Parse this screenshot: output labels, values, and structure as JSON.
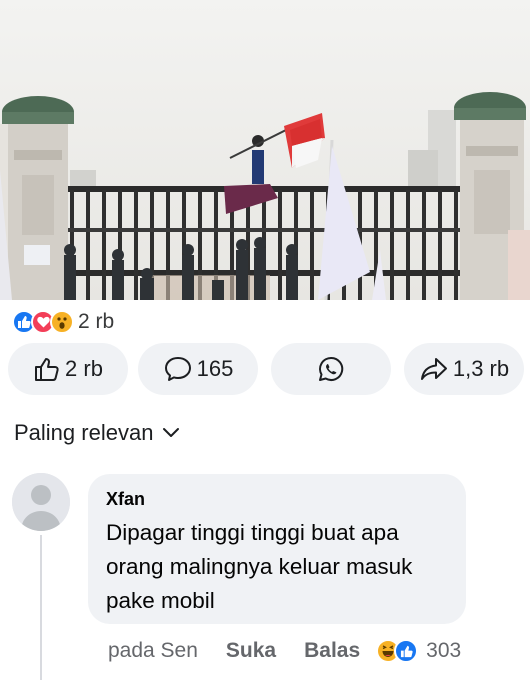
{
  "post": {
    "image_name": "protest-at-parliament-gate-photo",
    "reactions": {
      "icons": [
        "like-icon",
        "love-icon",
        "wow-icon"
      ],
      "count": "2 rb"
    }
  },
  "actions": {
    "like_count": "2 rb",
    "comment_count": "165",
    "share_count": "1,3 rb"
  },
  "comments_sort": {
    "label": "Paling relevan"
  },
  "comment": {
    "author": "Xfan",
    "text_lines": [
      "Dipagar tinggi tinggi buat apa",
      "orang malingnya keluar masuk",
      "pake mobil"
    ],
    "time": "pada Sen",
    "like_label": "Suka",
    "reply_label": "Balas",
    "reaction_icons": [
      "haha-icon",
      "like-icon"
    ],
    "reaction_count": "303"
  },
  "colors": {
    "like_blue": "#1877f2",
    "love_red": "#f33e58",
    "wow_yellow": "#f7b125",
    "pill_bg": "#f0f2f5",
    "muted_text": "#65676b"
  }
}
